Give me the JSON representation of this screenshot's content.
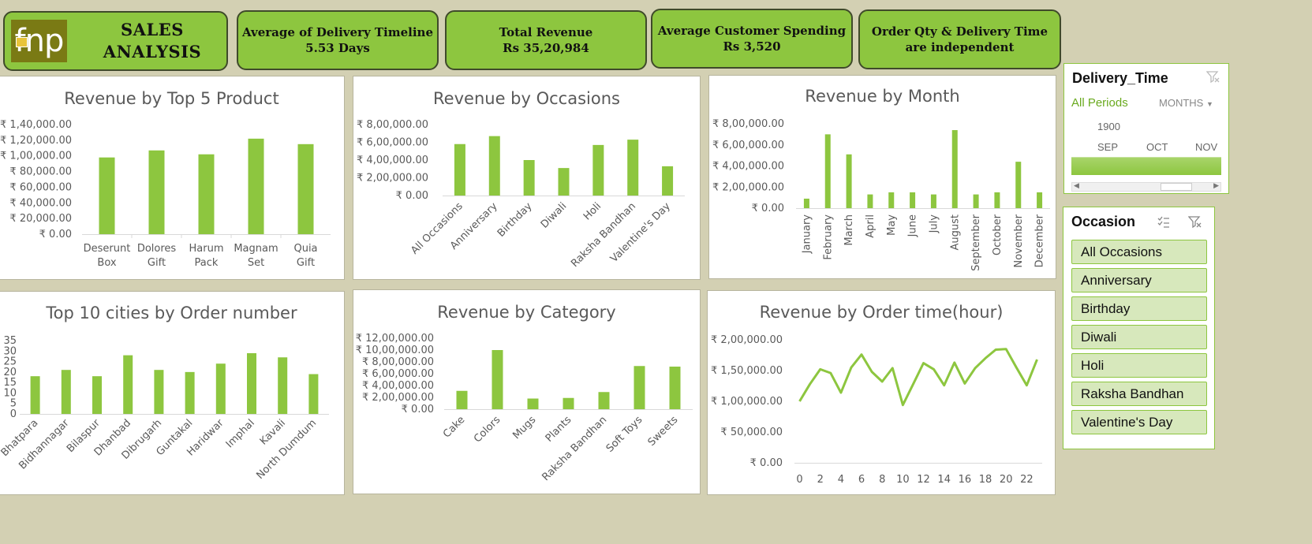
{
  "header": {
    "brand_logo_text": "fnp",
    "title": "SALES ANALYSIS",
    "kpis": [
      {
        "label": "Average of Delivery Timeline",
        "value": "5.53 Days"
      },
      {
        "label": "Total Revenue",
        "value": "Rs 35,20,984"
      },
      {
        "label": "Average Customer Spending",
        "value": "Rs 3,520"
      },
      {
        "label": "Order Qty & Delivery Time",
        "value": "are independent"
      }
    ]
  },
  "colors": {
    "accent": "#8dc63f",
    "background": "#d3d0b3",
    "card_border": "#3f4a2a"
  },
  "chart_data": [
    {
      "id": "top5",
      "type": "bar",
      "title": "Revenue by Top 5 Product",
      "categories": [
        "Deserunt Box",
        "Dolores Gift",
        "Harum Pack",
        "Magnam Set",
        "Quia Gift"
      ],
      "values": [
        98000,
        107000,
        102000,
        122000,
        115000
      ],
      "ylim": [
        0,
        140000
      ],
      "yticks": [
        "₹ 0.00",
        "₹ 20,000.00",
        "₹ 40,000.00",
        "₹ 60,000.00",
        "₹ 80,000.00",
        "₹ 1,00,000.00",
        "₹ 1,20,000.00",
        "₹ 1,40,000.00"
      ]
    },
    {
      "id": "occasions",
      "type": "bar",
      "title": "Revenue by Occasions",
      "categories": [
        "All Occasions",
        "Anniversary",
        "Birthday",
        "Diwali",
        "Holi",
        "Raksha Bandhan",
        "Valentine's Day"
      ],
      "values": [
        580000,
        670000,
        400000,
        310000,
        570000,
        630000,
        330000
      ],
      "ylim": [
        0,
        800000
      ],
      "yticks": [
        "₹ 0.00",
        "₹ 2,00,000.00",
        "₹ 4,00,000.00",
        "₹ 6,00,000.00",
        "₹ 8,00,000.00"
      ]
    },
    {
      "id": "month",
      "type": "bar",
      "title": "Revenue by Month",
      "categories": [
        "January",
        "February",
        "March",
        "April",
        "May",
        "June",
        "July",
        "August",
        "September",
        "October",
        "November",
        "December"
      ],
      "values": [
        90000,
        700000,
        510000,
        130000,
        150000,
        150000,
        130000,
        740000,
        130000,
        150000,
        440000,
        150000
      ],
      "ylim": [
        0,
        800000
      ],
      "yticks": [
        "₹ 0.00",
        "₹ 2,00,000.00",
        "₹ 4,00,000.00",
        "₹ 6,00,000.00",
        "₹ 8,00,000.00"
      ]
    },
    {
      "id": "cities",
      "type": "bar",
      "title": "Top 10 cities by Order number",
      "categories": [
        "Bhatpara",
        "Bidhannagar",
        "Bilaspur",
        "Dhanbad",
        "Dibrugarh",
        "Guntakal",
        "Haridwar",
        "Imphal",
        "Kavali",
        "North Dumdum"
      ],
      "values": [
        18,
        21,
        18,
        28,
        21,
        20,
        24,
        29,
        27,
        19
      ],
      "ylim": [
        0,
        35
      ],
      "yticks": [
        "0",
        "5",
        "10",
        "15",
        "20",
        "25",
        "30",
        "35"
      ]
    },
    {
      "id": "category",
      "type": "bar",
      "title": "Revenue by Category",
      "categories": [
        "Cake",
        "Colors",
        "Mugs",
        "Plants",
        "Raksha Bandhan",
        "Soft Toys",
        "Sweets"
      ],
      "values": [
        310000,
        1000000,
        180000,
        190000,
        290000,
        730000,
        720000
      ],
      "ylim": [
        0,
        1200000
      ],
      "yticks": [
        "₹ 0.00",
        "₹ 2,00,000.00",
        "₹ 4,00,000.00",
        "₹ 6,00,000.00",
        "₹ 8,00,000.00",
        "₹ 10,00,000.00",
        "₹ 12,00,000.00"
      ]
    },
    {
      "id": "hour",
      "type": "line",
      "title": "Revenue by Order time(hour)",
      "x": [
        0,
        1,
        2,
        3,
        4,
        5,
        6,
        7,
        8,
        9,
        10,
        11,
        12,
        13,
        14,
        15,
        16,
        17,
        18,
        19,
        20,
        21,
        22,
        23
      ],
      "values": [
        100000,
        128000,
        152000,
        146000,
        114000,
        155000,
        176000,
        148000,
        132000,
        154000,
        94000,
        128000,
        162000,
        152000,
        126000,
        163000,
        129000,
        154000,
        170000,
        184000,
        185000,
        155000,
        126000,
        168000
      ],
      "ylim": [
        0,
        200000
      ],
      "yticks": [
        "₹ 0.00",
        "₹ 50,000.00",
        "₹ 1,00,000.00",
        "₹ 1,50,000.00",
        "₹ 2,00,000.00"
      ],
      "xticks": [
        "0",
        "2",
        "4",
        "6",
        "8",
        "10",
        "12",
        "14",
        "16",
        "18",
        "20",
        "22"
      ]
    }
  ],
  "timeline": {
    "title": "Delivery_Time",
    "all_periods": "All Periods",
    "level": "MONTHS",
    "year": "1900",
    "months": [
      "SEP",
      "OCT",
      "NOV"
    ]
  },
  "occasion_slicer": {
    "title": "Occasion",
    "items": [
      "All Occasions",
      "Anniversary",
      "Birthday",
      "Diwali",
      "Holi",
      "Raksha Bandhan",
      "Valentine's Day"
    ]
  }
}
